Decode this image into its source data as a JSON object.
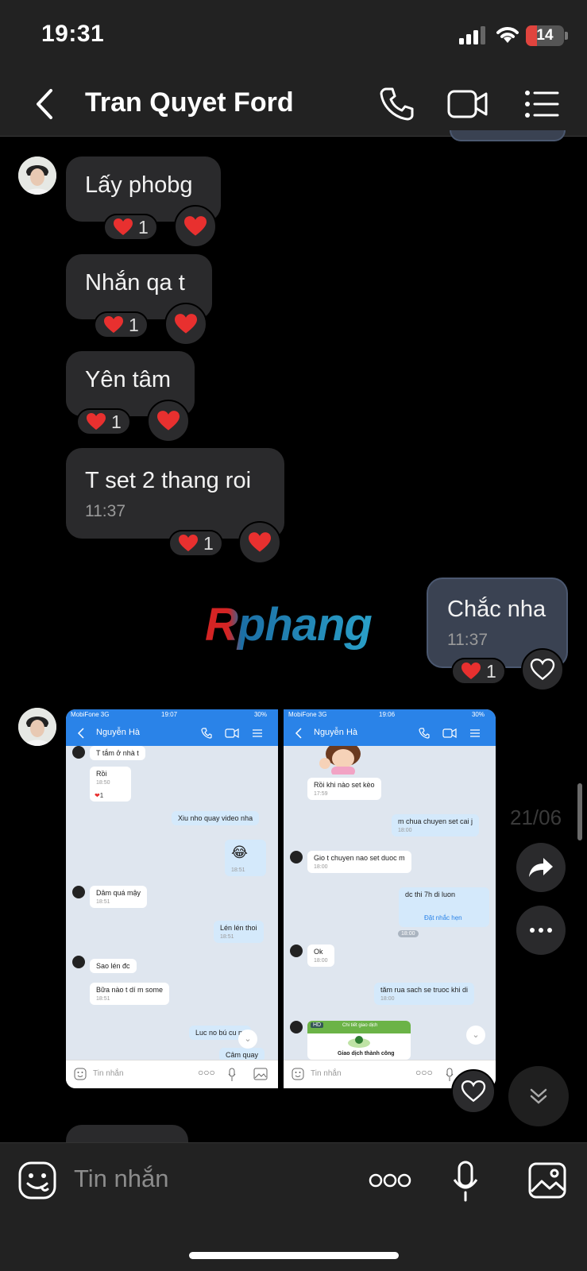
{
  "status": {
    "time": "19:31",
    "battery": "14"
  },
  "header": {
    "title": "Tran Quyet Ford"
  },
  "messages": [
    {
      "text": "Lấy phobg",
      "reaction_count": "1"
    },
    {
      "text": "Nhắn qa t",
      "reaction_count": "1"
    },
    {
      "text": "Yên tâm",
      "reaction_count": "1"
    },
    {
      "text": "T set 2 thang roi",
      "time": "11:37",
      "reaction_count": "1"
    }
  ],
  "outgoing": {
    "text": "Chắc nha",
    "time": "11:37",
    "reaction_count": "1"
  },
  "watermark": "Rphang",
  "shot_left": {
    "carrier": "MobiFone 3G",
    "time": "19:07",
    "battery": "30%",
    "name": "Nguyễn Hà",
    "msgs": [
      {
        "text": "T tắm ở nhà t"
      },
      {
        "text": "Rồi",
        "time": "18:50",
        "react": "1"
      },
      {
        "text": "Xiu nho quay video nha"
      },
      {
        "time": "18:51"
      },
      {
        "text": "Dâm quá mậy",
        "time": "18:51"
      },
      {
        "text": "Lén lén thoi",
        "time": "18:51"
      },
      {
        "text": "Sao lén đc"
      },
      {
        "text": "Bữa nào t dí m some",
        "time": "18:51"
      },
      {
        "text": "Luc no bú cu m"
      },
      {
        "text": "Câm quay"
      }
    ],
    "placeholder": "Tin nhắn"
  },
  "shot_right": {
    "carrier": "MobiFone 3G",
    "time": "19:06",
    "battery": "30%",
    "name": "Nguyễn Hà",
    "msgs": [
      {
        "text": "Rồi khi nào set kèo",
        "time": "17:59"
      },
      {
        "text": "m chua chuyen set cai j",
        "time": "18:00"
      },
      {
        "text": "Gio t chuyen nao set duoc m",
        "time": "18:00"
      },
      {
        "text": "dc thi 7h di luon",
        "link": "Đặt nhắc hẹn"
      },
      {
        "time": "18:00"
      },
      {
        "text": "Ok",
        "time": "18:00"
      },
      {
        "text": "tăm rua sach se truoc khi di",
        "time": "18:00"
      },
      {
        "text": "HD",
        "card_top": "Chi tiết giao dịch",
        "card_main": "Giao dịch thành công"
      }
    ],
    "placeholder": "Tin nhắn"
  },
  "date_overlay": "21/06",
  "input": {
    "placeholder": "Tin nhắn"
  },
  "colors": {
    "heart": "#e8302f",
    "bubble_in": "#2a2a2c",
    "bubble_out": "#3a4252",
    "zalo_blue": "#2a83e8"
  }
}
